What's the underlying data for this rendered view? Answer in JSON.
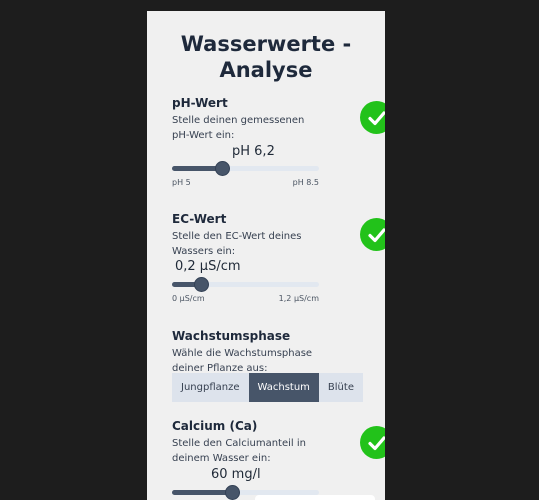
{
  "title": "Wasserwerte - Analyse",
  "ph": {
    "title": "pH-Wert",
    "description": "Stelle deinen gemessenen pH-Wert ein:",
    "value": "pH 6,2",
    "min": "pH 5",
    "max": "pH 8.5",
    "position": 0.34,
    "status_icon": "check-circle-icon"
  },
  "ec": {
    "title": "EC-Wert",
    "description": "Stelle den EC-Wert deines Wassers ein:",
    "value": "0,2 µS/cm",
    "min": "0 µS/cm",
    "max": "1,2 µS/cm",
    "position": 0.2,
    "status_icon": "check-circle-icon"
  },
  "phase": {
    "title": "Wachstumsphase",
    "description": "Wähle die Wachstumsphase deiner Pflanze aus:",
    "options": [
      "Jungpflanze",
      "Wachstum",
      "Blüte"
    ],
    "selected": "Wachstum"
  },
  "calcium": {
    "title": "Calcium (Ca)",
    "description": "Stelle den Calciumanteil in deinem Wasser ein:",
    "value": "60 mg/l",
    "position": 0.41,
    "status_icon": "check-circle-icon"
  },
  "colors": {
    "accent": "#475569",
    "success": "#22c21a",
    "track": "#e2e8f0",
    "panel": "#f0f0f0"
  }
}
